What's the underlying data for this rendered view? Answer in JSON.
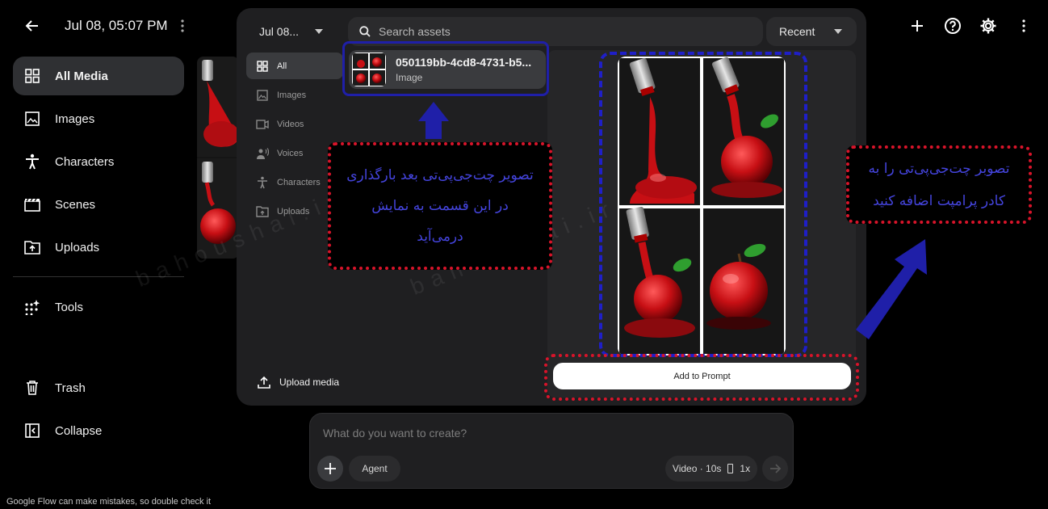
{
  "header": {
    "title": "Jul 08, 05:07 PM",
    "back_icon": "arrow-left-icon",
    "more_icon": "more-vertical-icon",
    "actions": [
      "plus-icon",
      "help-circle-icon",
      "gear-icon",
      "more-vertical-icon"
    ]
  },
  "sidebar": {
    "items": [
      {
        "label": "All Media",
        "icon": "grid-icon",
        "active": true
      },
      {
        "label": "Images",
        "icon": "image-icon"
      },
      {
        "label": "Characters",
        "icon": "person-icon"
      },
      {
        "label": "Scenes",
        "icon": "clapper-icon"
      },
      {
        "label": "Uploads",
        "icon": "upload-folder-icon"
      }
    ],
    "tools": {
      "label": "Tools",
      "icon": "sparkles-grid-icon"
    },
    "trash": {
      "label": "Trash",
      "icon": "trash-icon"
    },
    "collapse": {
      "label": "Collapse",
      "icon": "collapse-panel-icon"
    }
  },
  "modal": {
    "date_filter": "Jul 08...",
    "search_placeholder": "Search assets",
    "sort": "Recent",
    "filters": [
      {
        "label": "All",
        "icon": "grid-icon",
        "active": true
      },
      {
        "label": "Images",
        "icon": "image-icon"
      },
      {
        "label": "Videos",
        "icon": "video-icon"
      },
      {
        "label": "Voices",
        "icon": "voice-icon"
      },
      {
        "label": "Characters",
        "icon": "person-icon"
      },
      {
        "label": "Uploads",
        "icon": "upload-folder-icon"
      }
    ],
    "asset": {
      "name": "050119bb-4cd8-4731-b5...",
      "type": "Image"
    },
    "upload_label": "Upload media",
    "add_button": "Add to Prompt"
  },
  "annotations": {
    "note_left": [
      "تصویر چت‌جی‌پی‌تی بعد بارگذاری",
      "در این قسمت به نمایش",
      "درمی‌آید"
    ],
    "note_right": [
      "تصوبر چت‌جی‌پی‌تی را به",
      "کادر پرامپت اضافه کنید"
    ],
    "watermark": "bahoushai.ir",
    "colors": {
      "red": "#d8142a",
      "blue": "#1f1fa8"
    }
  },
  "prompt": {
    "placeholder": "What do you want to create?",
    "agent_label": "Agent",
    "video_label": "Video · 10s",
    "count_label": "1x"
  },
  "footer": {
    "disclaimer": "Google Flow can make mistakes, so double check it"
  }
}
